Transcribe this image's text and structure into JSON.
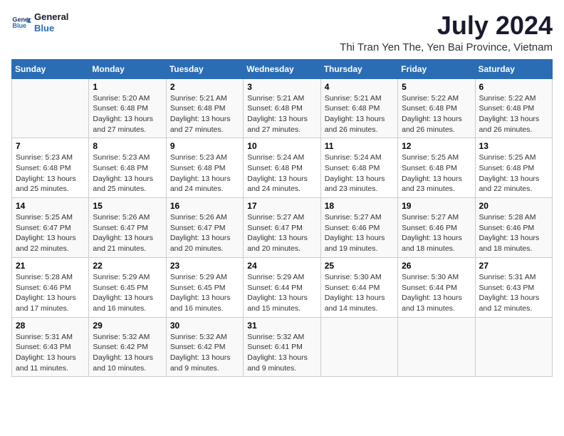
{
  "logo": {
    "line1": "General",
    "line2": "Blue"
  },
  "title": "July 2024",
  "subtitle": "Thi Tran Yen The, Yen Bai Province, Vietnam",
  "weekdays": [
    "Sunday",
    "Monday",
    "Tuesday",
    "Wednesday",
    "Thursday",
    "Friday",
    "Saturday"
  ],
  "weeks": [
    [
      {
        "day": "",
        "info": ""
      },
      {
        "day": "1",
        "info": "Sunrise: 5:20 AM\nSunset: 6:48 PM\nDaylight: 13 hours\nand 27 minutes."
      },
      {
        "day": "2",
        "info": "Sunrise: 5:21 AM\nSunset: 6:48 PM\nDaylight: 13 hours\nand 27 minutes."
      },
      {
        "day": "3",
        "info": "Sunrise: 5:21 AM\nSunset: 6:48 PM\nDaylight: 13 hours\nand 27 minutes."
      },
      {
        "day": "4",
        "info": "Sunrise: 5:21 AM\nSunset: 6:48 PM\nDaylight: 13 hours\nand 26 minutes."
      },
      {
        "day": "5",
        "info": "Sunrise: 5:22 AM\nSunset: 6:48 PM\nDaylight: 13 hours\nand 26 minutes."
      },
      {
        "day": "6",
        "info": "Sunrise: 5:22 AM\nSunset: 6:48 PM\nDaylight: 13 hours\nand 26 minutes."
      }
    ],
    [
      {
        "day": "7",
        "info": "Sunrise: 5:23 AM\nSunset: 6:48 PM\nDaylight: 13 hours\nand 25 minutes."
      },
      {
        "day": "8",
        "info": "Sunrise: 5:23 AM\nSunset: 6:48 PM\nDaylight: 13 hours\nand 25 minutes."
      },
      {
        "day": "9",
        "info": "Sunrise: 5:23 AM\nSunset: 6:48 PM\nDaylight: 13 hours\nand 24 minutes."
      },
      {
        "day": "10",
        "info": "Sunrise: 5:24 AM\nSunset: 6:48 PM\nDaylight: 13 hours\nand 24 minutes."
      },
      {
        "day": "11",
        "info": "Sunrise: 5:24 AM\nSunset: 6:48 PM\nDaylight: 13 hours\nand 23 minutes."
      },
      {
        "day": "12",
        "info": "Sunrise: 5:25 AM\nSunset: 6:48 PM\nDaylight: 13 hours\nand 23 minutes."
      },
      {
        "day": "13",
        "info": "Sunrise: 5:25 AM\nSunset: 6:48 PM\nDaylight: 13 hours\nand 22 minutes."
      }
    ],
    [
      {
        "day": "14",
        "info": "Sunrise: 5:25 AM\nSunset: 6:47 PM\nDaylight: 13 hours\nand 22 minutes."
      },
      {
        "day": "15",
        "info": "Sunrise: 5:26 AM\nSunset: 6:47 PM\nDaylight: 13 hours\nand 21 minutes."
      },
      {
        "day": "16",
        "info": "Sunrise: 5:26 AM\nSunset: 6:47 PM\nDaylight: 13 hours\nand 20 minutes."
      },
      {
        "day": "17",
        "info": "Sunrise: 5:27 AM\nSunset: 6:47 PM\nDaylight: 13 hours\nand 20 minutes."
      },
      {
        "day": "18",
        "info": "Sunrise: 5:27 AM\nSunset: 6:46 PM\nDaylight: 13 hours\nand 19 minutes."
      },
      {
        "day": "19",
        "info": "Sunrise: 5:27 AM\nSunset: 6:46 PM\nDaylight: 13 hours\nand 18 minutes."
      },
      {
        "day": "20",
        "info": "Sunrise: 5:28 AM\nSunset: 6:46 PM\nDaylight: 13 hours\nand 18 minutes."
      }
    ],
    [
      {
        "day": "21",
        "info": "Sunrise: 5:28 AM\nSunset: 6:46 PM\nDaylight: 13 hours\nand 17 minutes."
      },
      {
        "day": "22",
        "info": "Sunrise: 5:29 AM\nSunset: 6:45 PM\nDaylight: 13 hours\nand 16 minutes."
      },
      {
        "day": "23",
        "info": "Sunrise: 5:29 AM\nSunset: 6:45 PM\nDaylight: 13 hours\nand 16 minutes."
      },
      {
        "day": "24",
        "info": "Sunrise: 5:29 AM\nSunset: 6:44 PM\nDaylight: 13 hours\nand 15 minutes."
      },
      {
        "day": "25",
        "info": "Sunrise: 5:30 AM\nSunset: 6:44 PM\nDaylight: 13 hours\nand 14 minutes."
      },
      {
        "day": "26",
        "info": "Sunrise: 5:30 AM\nSunset: 6:44 PM\nDaylight: 13 hours\nand 13 minutes."
      },
      {
        "day": "27",
        "info": "Sunrise: 5:31 AM\nSunset: 6:43 PM\nDaylight: 13 hours\nand 12 minutes."
      }
    ],
    [
      {
        "day": "28",
        "info": "Sunrise: 5:31 AM\nSunset: 6:43 PM\nDaylight: 13 hours\nand 11 minutes."
      },
      {
        "day": "29",
        "info": "Sunrise: 5:32 AM\nSunset: 6:42 PM\nDaylight: 13 hours\nand 10 minutes."
      },
      {
        "day": "30",
        "info": "Sunrise: 5:32 AM\nSunset: 6:42 PM\nDaylight: 13 hours\nand 9 minutes."
      },
      {
        "day": "31",
        "info": "Sunrise: 5:32 AM\nSunset: 6:41 PM\nDaylight: 13 hours\nand 9 minutes."
      },
      {
        "day": "",
        "info": ""
      },
      {
        "day": "",
        "info": ""
      },
      {
        "day": "",
        "info": ""
      }
    ]
  ]
}
